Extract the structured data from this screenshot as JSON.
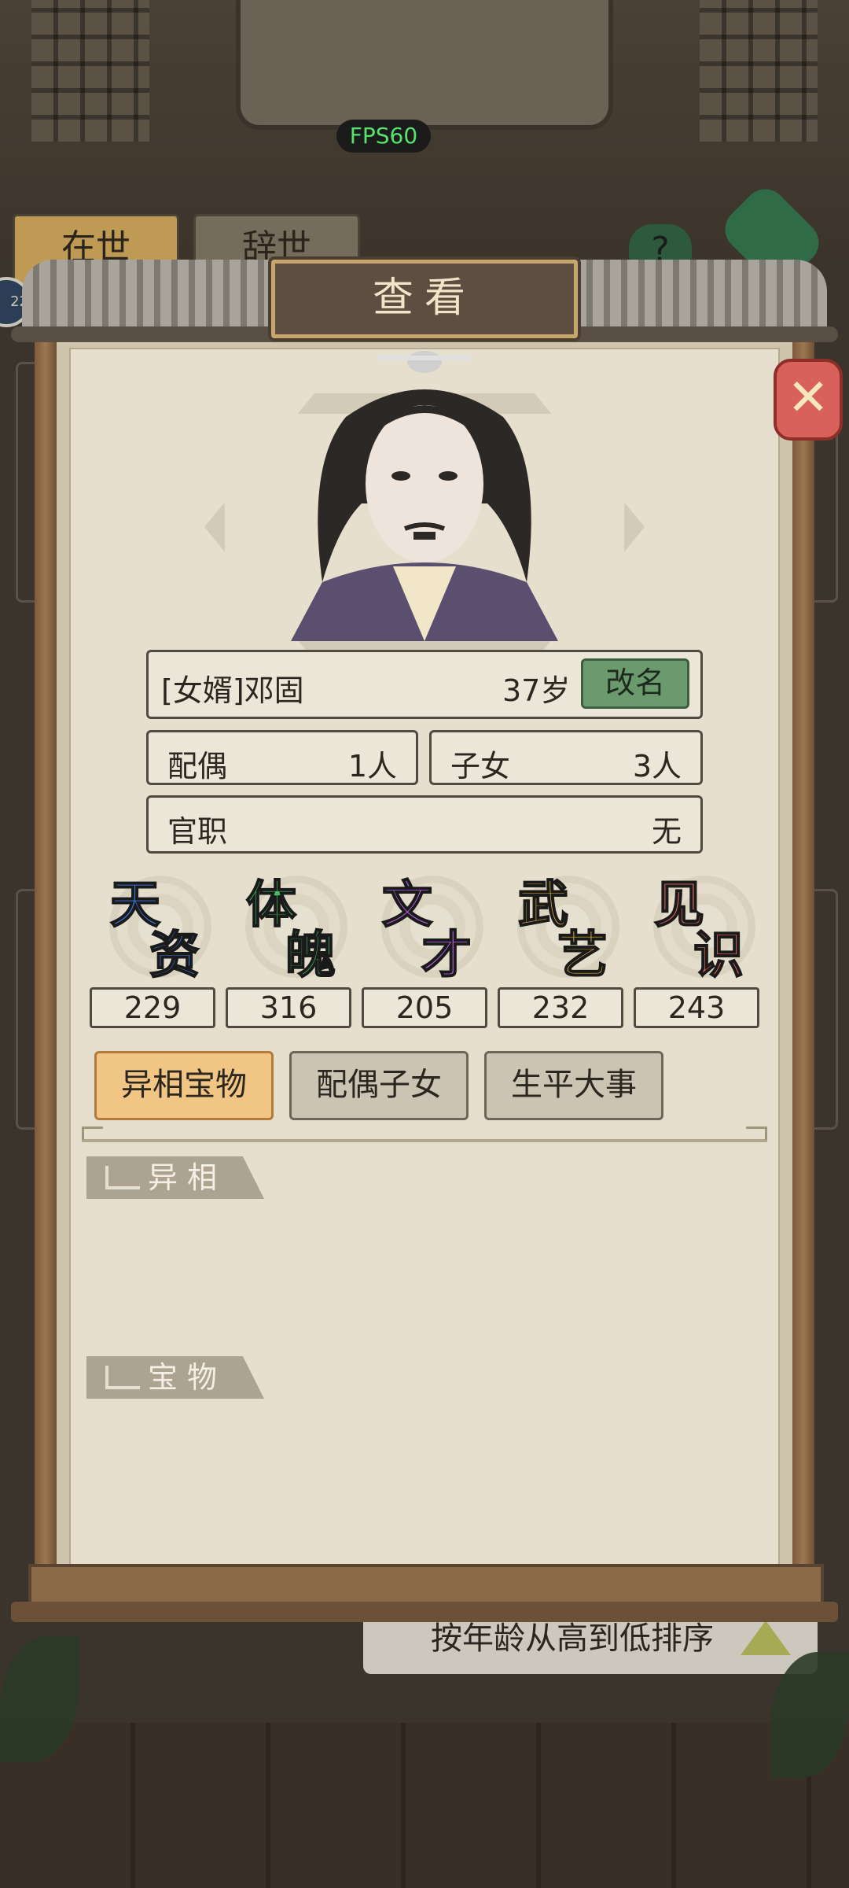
{
  "hud": {
    "fps": "FPS60"
  },
  "background": {
    "tabs": [
      "在世",
      "辞世"
    ],
    "help": "?",
    "badge": "22",
    "sort_label": "按年龄从高到低排序"
  },
  "dialog": {
    "title": "查看",
    "close_icon": "close-x-icon",
    "person": {
      "name": "[女婿]邓固",
      "age": "37岁",
      "rename_label": "改名",
      "spouse_label": "配偶",
      "spouse_value": "1人",
      "children_label": "子女",
      "children_value": "3人",
      "office_label": "官职",
      "office_value": "无"
    },
    "attributes": [
      {
        "c1": "天",
        "c2": "资",
        "value": "229",
        "color": "#3d7cf0"
      },
      {
        "c1": "体",
        "c2": "魄",
        "value": "316",
        "color": "#3fbf63"
      },
      {
        "c1": "文",
        "c2": "才",
        "value": "205",
        "color": "#b45be0"
      },
      {
        "c1": "武",
        "c2": "艺",
        "value": "232",
        "color": "#e7b13b"
      },
      {
        "c1": "见",
        "c2": "识",
        "value": "243",
        "color": "#ea6a5e"
      }
    ],
    "tabs": [
      "异相宝物",
      "配偶子女",
      "生平大事"
    ],
    "active_tab": 0,
    "sections": [
      "异相",
      "宝物"
    ]
  }
}
